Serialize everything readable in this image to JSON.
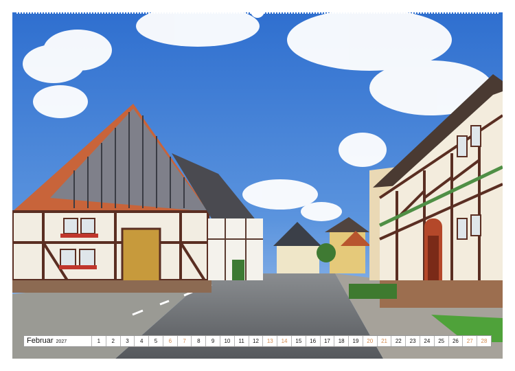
{
  "calendar": {
    "month": "Februar",
    "year": "2027",
    "days": [
      {
        "n": "1",
        "weekend": false
      },
      {
        "n": "2",
        "weekend": false
      },
      {
        "n": "3",
        "weekend": false
      },
      {
        "n": "4",
        "weekend": false
      },
      {
        "n": "5",
        "weekend": false
      },
      {
        "n": "6",
        "weekend": true
      },
      {
        "n": "7",
        "weekend": true
      },
      {
        "n": "8",
        "weekend": false
      },
      {
        "n": "9",
        "weekend": false
      },
      {
        "n": "10",
        "weekend": false
      },
      {
        "n": "11",
        "weekend": false
      },
      {
        "n": "12",
        "weekend": false
      },
      {
        "n": "13",
        "weekend": true
      },
      {
        "n": "14",
        "weekend": true
      },
      {
        "n": "15",
        "weekend": false
      },
      {
        "n": "16",
        "weekend": false
      },
      {
        "n": "17",
        "weekend": false
      },
      {
        "n": "18",
        "weekend": false
      },
      {
        "n": "19",
        "weekend": false
      },
      {
        "n": "20",
        "weekend": true
      },
      {
        "n": "21",
        "weekend": true
      },
      {
        "n": "22",
        "weekend": false
      },
      {
        "n": "23",
        "weekend": false
      },
      {
        "n": "24",
        "weekend": false
      },
      {
        "n": "25",
        "weekend": false
      },
      {
        "n": "26",
        "weekend": false
      },
      {
        "n": "27",
        "weekend": true
      },
      {
        "n": "28",
        "weekend": true
      }
    ],
    "colors": {
      "weekday": "#111111",
      "weekend": "#d08a4f",
      "border": "#9a9a9a"
    }
  },
  "photo": {
    "subject": "village-street-half-timbered-houses",
    "colors": {
      "sky": "#3f7fd6",
      "roof": "#c8643a",
      "timber": "#5a2e22",
      "plaster": "#f2ede2",
      "road": "#6f7276"
    }
  }
}
